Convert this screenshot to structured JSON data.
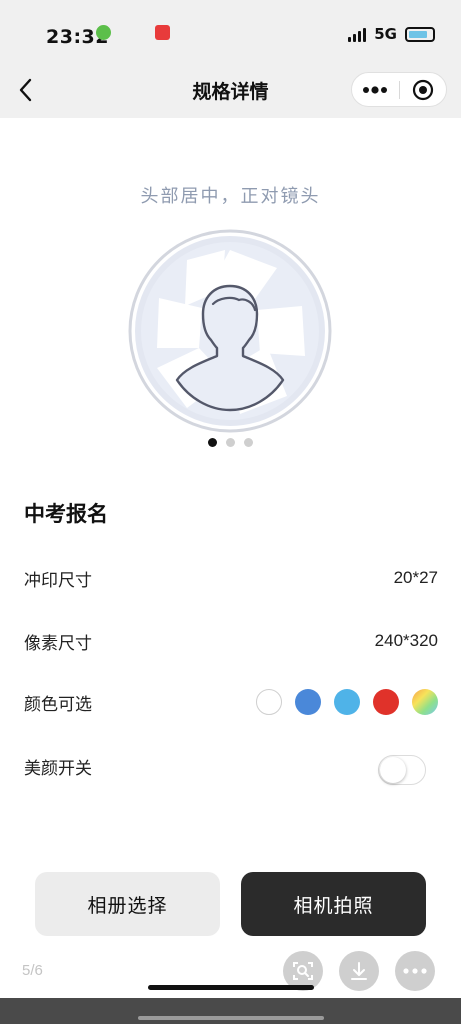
{
  "status_bar": {
    "time": "23:32",
    "network": "5G"
  },
  "nav": {
    "title": "规格详情"
  },
  "preview": {
    "hint": "头部居中，正对镜头",
    "page_dots": 3,
    "active_dot": 0
  },
  "spec": {
    "title": "中考报名",
    "print_size": {
      "label": "冲印尺寸",
      "value": "20*27"
    },
    "pixel_size": {
      "label": "像素尺寸",
      "value": "240*320"
    },
    "background_color": {
      "label": "颜色可选",
      "options": [
        {
          "name": "white",
          "color": "#ffffff"
        },
        {
          "name": "blue",
          "color": "#4a88d9"
        },
        {
          "name": "light-blue",
          "color": "#4fb3e8"
        },
        {
          "name": "red",
          "color": "#e0322a"
        },
        {
          "name": "gradient",
          "color": "rainbow"
        }
      ]
    },
    "beauty": {
      "label": "美颜开关",
      "enabled": false
    }
  },
  "actions": {
    "album_label": "相册选择",
    "camera_label": "相机拍照"
  },
  "overlay": {
    "page_indicator": "5/6"
  }
}
